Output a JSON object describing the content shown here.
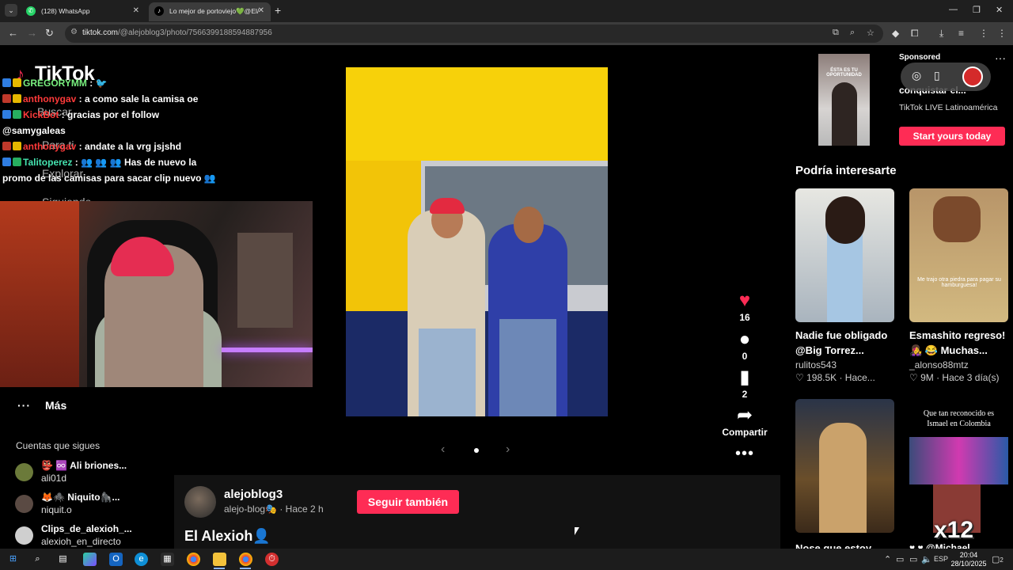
{
  "browser": {
    "tabs": [
      {
        "title": "(128) WhatsApp",
        "icon": "whatsapp-icon"
      },
      {
        "title": "Lo mejor de portoviejo💚@El/",
        "icon": "tiktok-icon"
      }
    ],
    "url_host": "tiktok.com",
    "url_path": "/@alejoblog3/photo/7566399188594887956"
  },
  "tiktok": {
    "logo": "TikTok",
    "ghost_nav": {
      "search": "Buscar",
      "for_you": "Para ti",
      "explore": "Explorar",
      "following": "Siguiendo"
    },
    "more_label": "Más",
    "following_title": "Cuentas que sigues",
    "following_accounts": [
      {
        "name": "👺 ♾️ Ali briones...",
        "handle": "ali01d"
      },
      {
        "name": "🦊🕷️ Niquito🦍...",
        "handle": "niquit.o"
      },
      {
        "name": "Clips_de_alexioh_...",
        "handle": "alexioh_en_directo"
      }
    ]
  },
  "stream_chat": [
    {
      "user": "GREGORYMM",
      "sep": " : ",
      "msg": "🐦",
      "color": "#79f07f"
    },
    {
      "user": "anthonygav",
      "sep": " : ",
      "msg": "a como sale la camisa oe",
      "color": "#ff3a3a"
    },
    {
      "user": "KickBot",
      "sep": " : ",
      "msg": "gracias por el follow",
      "color": "#ff3a3a"
    },
    {
      "user": "",
      "sep": "",
      "msg": "@samygaleas",
      "color": "#ffffff"
    },
    {
      "user": "anthonygav",
      "sep": " : ",
      "msg": "andate a la vrg jsjshd",
      "color": "#ff3a3a"
    },
    {
      "user": "Talitoperez",
      "sep": " : ",
      "msg": "👥 👥 👥 Has de nuevo la",
      "color": "#45e3b0"
    },
    {
      "user": "",
      "sep": "",
      "msg": "promo de las camisas para sacar clip nuevo 👥",
      "color": "#ffffff"
    }
  ],
  "post": {
    "actions": {
      "likes": "16",
      "comments": "0",
      "saves": "2",
      "share_label": "Compartir"
    },
    "author": {
      "username": "alejoblog3",
      "nickname": "alejo-blog🎭",
      "time": "· Hace 2 h"
    },
    "follow_label": "Seguir también",
    "caption": "El Alexioh👤"
  },
  "ad": {
    "sponsored": "Sponsored",
    "title": "conquistar el...",
    "subtitle": "TikTok LIVE Latinoamérica",
    "thumb_text": "ÉSTA ES TU OPORTUNIDAD",
    "cta": "Start yours today"
  },
  "recommendations": {
    "title": "Podría interesarte",
    "items": [
      {
        "title": "Nadie fue obligado @Big Torrez...",
        "user": "rulitos543",
        "stats": "♡ 198.5K · Hace..."
      },
      {
        "title": "Esmashito regreso! 👩‍🎤 😂 Muchas...",
        "user": "_alonso88mtz",
        "stats": "♡ 9M · Hace 3 día(s)",
        "thumb_caption": "Me trajo otra piedra para pagar su hamburguesa!"
      },
      {
        "title": "Nose que estoy",
        "user": "",
        "stats": ""
      },
      {
        "title": "♥ ♥ @Michael",
        "user": "",
        "stats": "",
        "thumb_caption": "Que tan reconocido es Ismael en Colombia"
      }
    ]
  },
  "overlay_badge": "x12",
  "taskbar": {
    "lang": "ESP",
    "time": "20:04",
    "date": "28/10/2025",
    "notif_count": "2"
  },
  "colors": {
    "accent": "#fe2c55",
    "chrome": "#1f1f1f",
    "addressbar": "#3c3c3c"
  }
}
